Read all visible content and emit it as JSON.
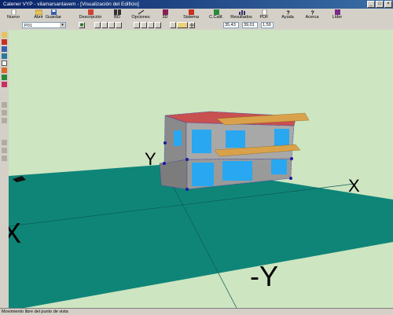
{
  "window": {
    "title": "Calener VYP - vilamarsantavem - [Visualización del Edificio]"
  },
  "toolbar": {
    "buttons": [
      {
        "label": "Nuevo",
        "icon": "new-file-icon"
      },
      {
        "label": "Abrir",
        "icon": "open-folder-icon"
      },
      {
        "label": "Guardar",
        "icon": "save-icon"
      },
      {
        "label": "Descripción",
        "icon": "description-icon"
      },
      {
        "label": "BD",
        "icon": "database-icon"
      },
      {
        "label": "Opciones",
        "icon": "options-icon"
      },
      {
        "label": "3D",
        "icon": "3d-icon"
      },
      {
        "label": "Sistema",
        "icon": "system-icon"
      },
      {
        "label": "C.Calif.",
        "icon": "rating-icon"
      },
      {
        "label": "Resultados",
        "icon": "results-icon"
      },
      {
        "label": "PDF",
        "icon": "pdf-icon"
      },
      {
        "label": "Ayuda",
        "icon": "help-icon"
      },
      {
        "label": "Acerca",
        "icon": "about-icon"
      },
      {
        "label": "Líder",
        "icon": "lider-icon"
      }
    ]
  },
  "toolbar2": {
    "floor_select": "P01",
    "coord_x": "35,43",
    "coord_y": "39,01",
    "zoom": "1,59"
  },
  "viewport": {
    "axis_x": "X",
    "axis_y": "Y",
    "axis_neg_y": "-Y",
    "axis_neg_x": "-X"
  },
  "status": {
    "text": "Movimiento libre del punto de vista"
  },
  "colors": {
    "ground": "#0f8578",
    "background": "#cde5c1",
    "roof": "#c85050",
    "walls": "#8a8a8a",
    "windows": "#29a7f0",
    "overhang": "#d9a24a"
  }
}
